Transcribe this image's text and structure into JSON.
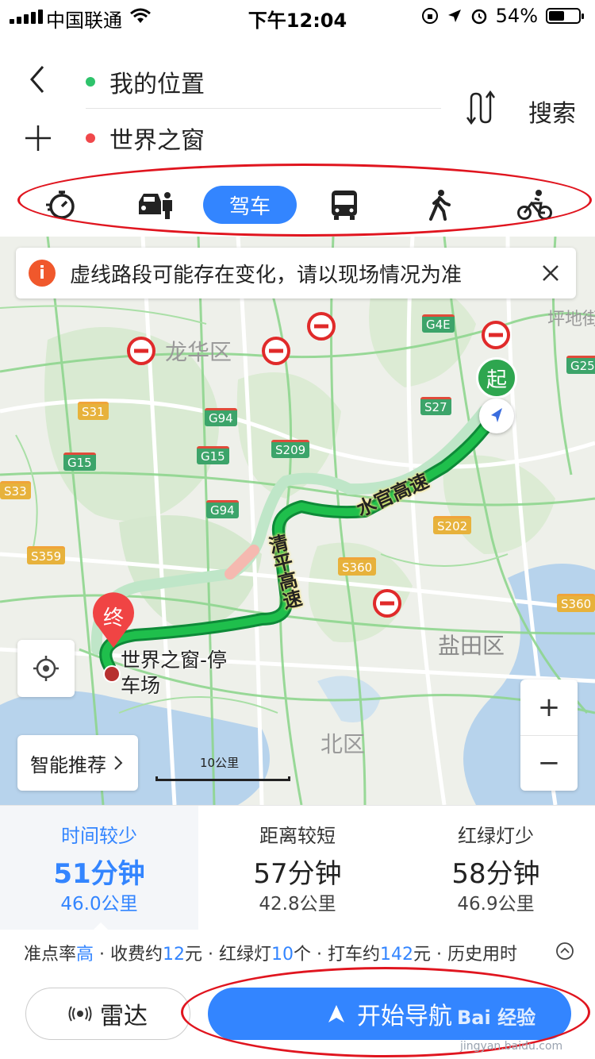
{
  "status": {
    "carrier": "中国联通",
    "time": "下午12:04",
    "battery": "54%",
    "battery_level": 0.54
  },
  "route": {
    "from": "我的位置",
    "to": "世界之窗",
    "search_label": "搜索"
  },
  "modes": {
    "active_label": "驾车"
  },
  "map": {
    "notice": "虚线路段可能存在变化，请以现场情况为准",
    "labels": {
      "longhua": "龙华区",
      "yantian": "盐田区",
      "north": "北区",
      "pingdi": "坪地街",
      "road_shuiguan": "水官高速",
      "road_qingping": "清平高速",
      "dest_name": "世界之窗-停",
      "dest_name2": "车场",
      "start": "起",
      "end": "终"
    },
    "shields": [
      "G4E",
      "S27",
      "G25",
      "S31",
      "G94",
      "G15",
      "S209",
      "G15",
      "G94",
      "S202",
      "S360",
      "S359",
      "S360",
      "S33"
    ],
    "scale": "10公里",
    "smart_label": "智能推荐",
    "zoom_in": "+",
    "zoom_out": "−"
  },
  "routes": [
    {
      "tag": "时间较少",
      "duration": "51分钟",
      "distance": "46.0公里"
    },
    {
      "tag": "距离较短",
      "duration": "57分钟",
      "distance": "42.8公里"
    },
    {
      "tag": "红绿灯少",
      "duration": "58分钟",
      "distance": "46.9公里"
    }
  ],
  "info": {
    "p1": "准点率",
    "v1": "高",
    "p2": " · 收费约",
    "v2": "12",
    "p3": "元 · 红绿灯",
    "v3": "10",
    "p4": "个 · 打车约",
    "v4": "142",
    "p5": "元 · 历史用时"
  },
  "actions": {
    "radar": "雷达",
    "navigate": "开始导航"
  },
  "watermark": {
    "brand": "Bai 经验",
    "url": "jingyan.baidu.com"
  },
  "colors": {
    "accent": "#3385ff",
    "annotation": "#e0151f",
    "route": "#1fbf4c"
  }
}
